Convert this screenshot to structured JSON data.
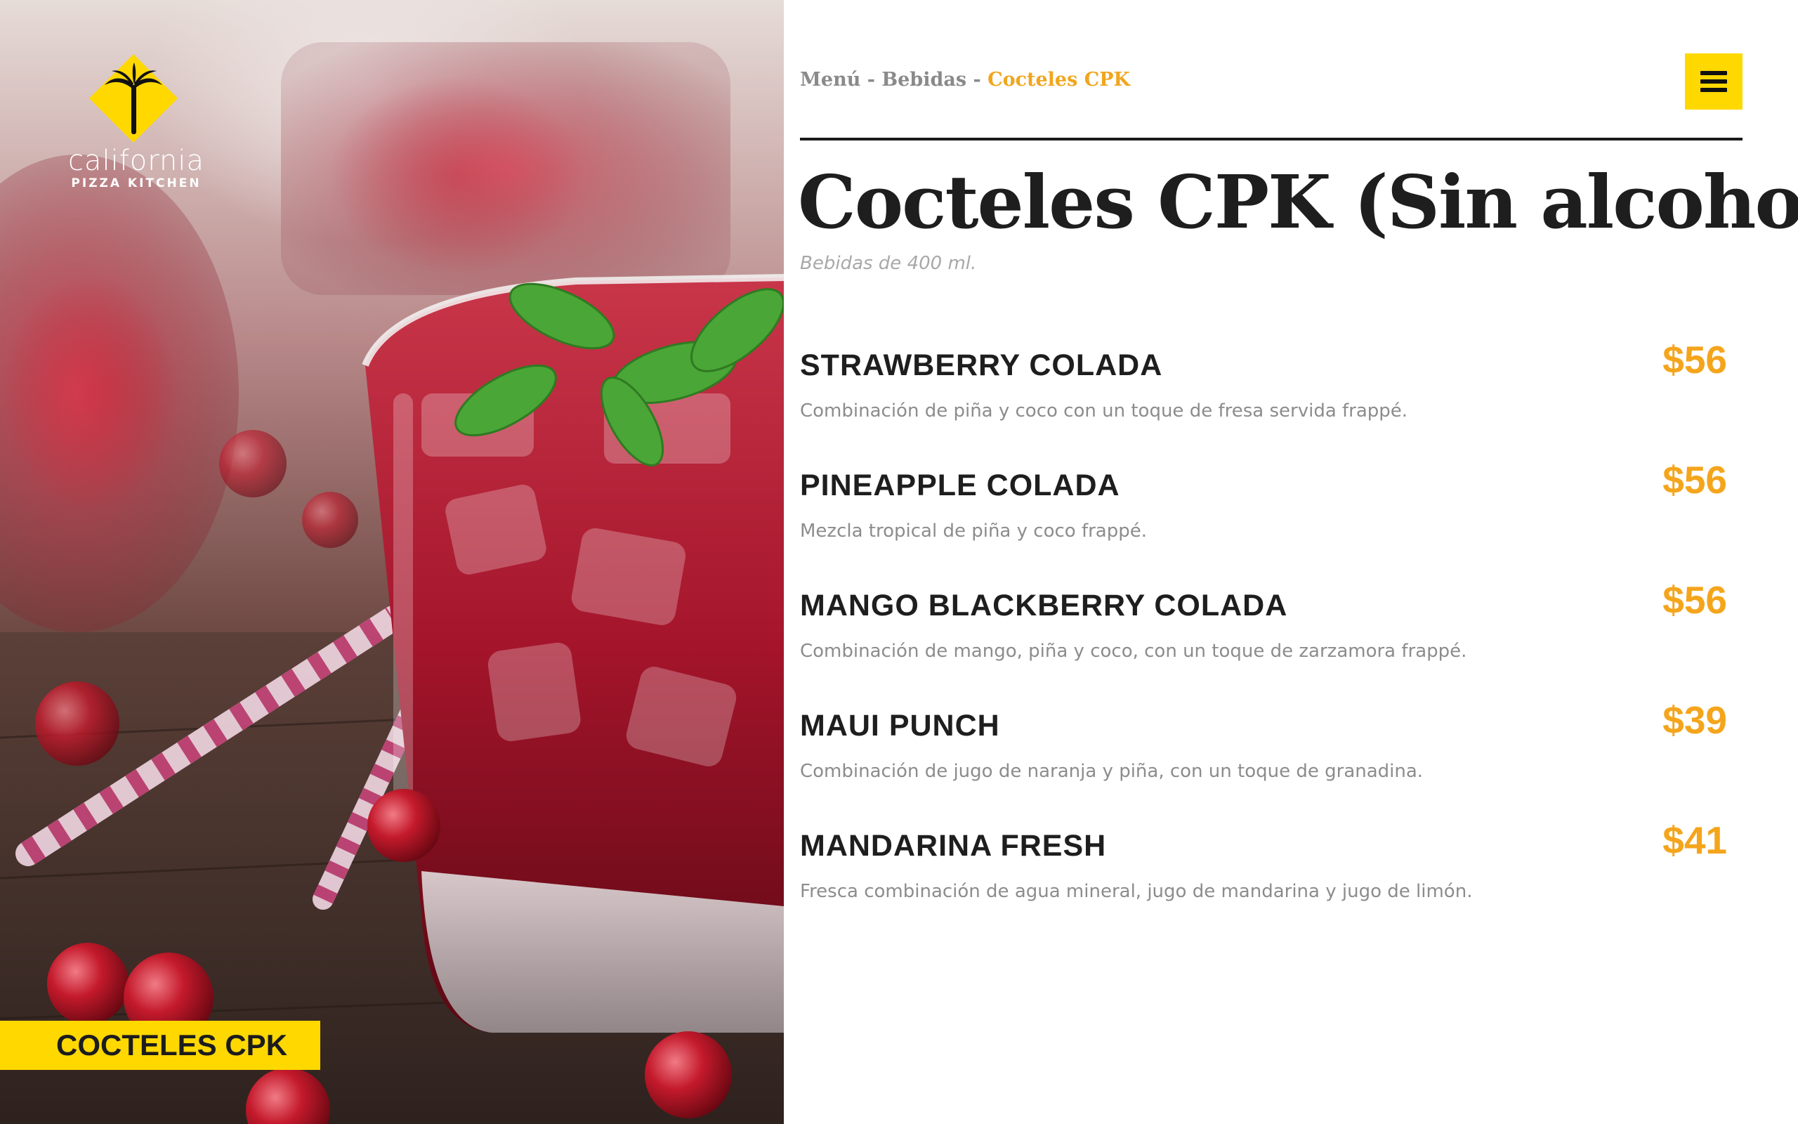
{
  "brand": {
    "line1": "california",
    "line2": "PIZZA KITCHEN",
    "logo_icon": "palm-tree-diamond-logo"
  },
  "hero": {
    "category_tag": "COCTELES CPK"
  },
  "breadcrumb": {
    "level1": "Menú",
    "separator1": " - ",
    "level2": "Bebidas",
    "separator2": " - ",
    "current": "Cocteles CPK"
  },
  "menu_button": {
    "icon": "hamburger-menu-icon"
  },
  "page": {
    "title": "Cocteles CPK (Sin alcohol)",
    "subtitle": "Bebidas de 400 ml."
  },
  "items": [
    {
      "name": "STRAWBERRY COLADA",
      "description": "Combinación de piña y coco con un toque de fresa servida frappé.",
      "price": "$56"
    },
    {
      "name": "PINEAPPLE COLADA",
      "description": "Mezcla tropical de piña y coco frappé.",
      "price": "$56"
    },
    {
      "name": "MANGO BLACKBERRY COLADA",
      "description": "Combinación de mango, piña y coco, con un toque de zarzamora frappé.",
      "price": "$56"
    },
    {
      "name": "MAUI PUNCH",
      "description": "Combinación de jugo de naranja y piña, con un toque de granadina.",
      "price": "$39"
    },
    {
      "name": "MANDARINA FRESH",
      "description": "Fresca combinación de agua mineral, jugo de mandarina y jugo de limón.",
      "price": "$41"
    }
  ],
  "colors": {
    "accent_yellow": "#ffd800",
    "price_orange": "#f4a51c",
    "text_dark": "#1e1e1e",
    "text_muted": "#8c8c8c"
  }
}
